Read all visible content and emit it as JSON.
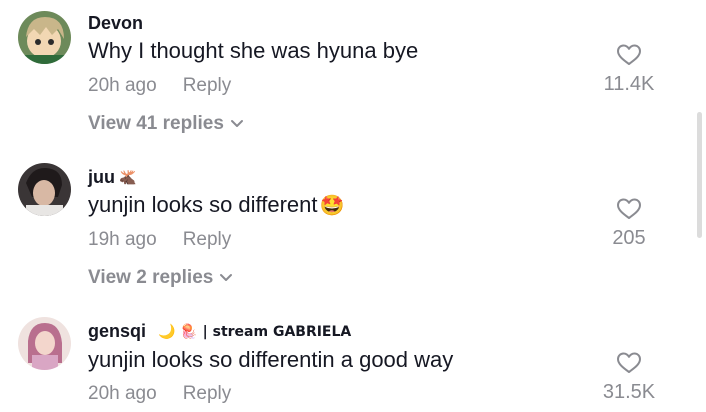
{
  "comments": [
    {
      "username": "Devon",
      "username_suffix": "",
      "text": "Why I thought she was hyuna bye",
      "text_emoji": "",
      "time": "20h ago",
      "reply_label": "Reply",
      "likes": "11.4K",
      "view_replies": "View 41 replies",
      "avatar_icon": "anime-character-avatar"
    },
    {
      "username": "juu",
      "username_suffix": "🫎",
      "text": "yunjin looks so different",
      "text_emoji": "🤩",
      "time": "19h ago",
      "reply_label": "Reply",
      "likes": "205",
      "view_replies": "View 2 replies",
      "avatar_icon": "person-photo-avatar"
    },
    {
      "username": "gensqi",
      "username_suffix": "🌙 🪼 | stream GABRIELA",
      "text": "yunjin looks so differentin a good way",
      "text_emoji": "",
      "time": "20h ago",
      "reply_label": "Reply",
      "likes": "31.5K",
      "view_replies": "",
      "avatar_icon": "doll-photo-avatar"
    }
  ],
  "colors": {
    "primary_text": "#161823",
    "secondary_text": "#8a8b91",
    "background": "#ffffff"
  }
}
